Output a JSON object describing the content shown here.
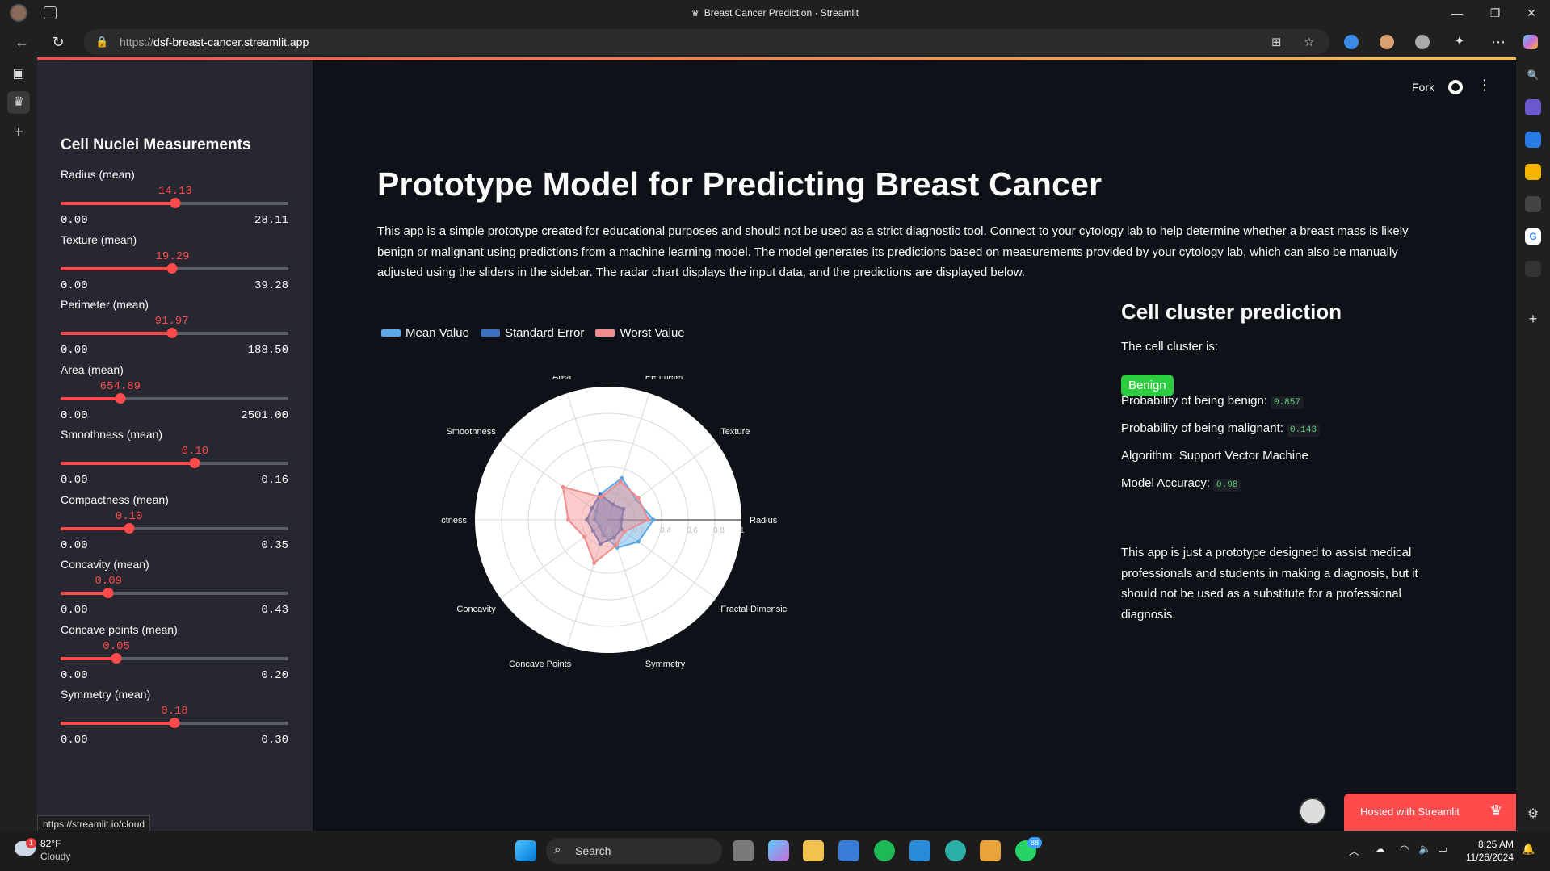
{
  "browser": {
    "window_title": "Breast Cancer Prediction · Streamlit",
    "url_prefix": "https://",
    "url_host": "dsf-breast-cancer.streamlit.app",
    "status_url": "https://streamlit.io/cloud"
  },
  "sidebar": {
    "title": "Cell Nuclei Measurements",
    "sliders": [
      {
        "label": "Radius (mean)",
        "value": "14.13",
        "min": "0.00",
        "max": "28.11",
        "fraction": 0.503
      },
      {
        "label": "Texture (mean)",
        "value": "19.29",
        "min": "0.00",
        "max": "39.28",
        "fraction": 0.491
      },
      {
        "label": "Perimeter (mean)",
        "value": "91.97",
        "min": "0.00",
        "max": "188.50",
        "fraction": 0.488
      },
      {
        "label": "Area (mean)",
        "value": "654.89",
        "min": "0.00",
        "max": "2501.00",
        "fraction": 0.262
      },
      {
        "label": "Smoothness (mean)",
        "value": "0.10",
        "min": "0.00",
        "max": "0.16",
        "fraction": 0.59
      },
      {
        "label": "Compactness (mean)",
        "value": "0.10",
        "min": "0.00",
        "max": "0.35",
        "fraction": 0.3
      },
      {
        "label": "Concavity (mean)",
        "value": "0.09",
        "min": "0.00",
        "max": "0.43",
        "fraction": 0.21
      },
      {
        "label": "Concave points (mean)",
        "value": "0.05",
        "min": "0.00",
        "max": "0.20",
        "fraction": 0.245
      },
      {
        "label": "Symmetry (mean)",
        "value": "0.18",
        "min": "0.00",
        "max": "0.30",
        "fraction": 0.5
      }
    ]
  },
  "header": {
    "fork_label": "Fork"
  },
  "main": {
    "title": "Prototype Model for Predicting Breast Cancer",
    "description": "This app is a simple prototype created for educational purposes and should not be used as a strict diagnostic tool. Connect to your cytology lab to help determine whether a breast mass is likely benign or malignant using predictions from a machine learning model. The model generates its predictions based on measurements provided by your cytology lab, which can also be manually adjusted using the sliders in the sidebar. The radar chart displays the input data, and the predictions are displayed below."
  },
  "chart_data": {
    "type": "radar",
    "categories": [
      "Radius",
      "Texture",
      "Perimeter",
      "Area",
      "Smoothness",
      "Compactness",
      "Concavity",
      "Concave Points",
      "Symmetry",
      "Fractal Dimension"
    ],
    "category_labels_shown": [
      "Radius",
      "Texture",
      "Perimeter",
      "Area",
      "Smoothness",
      "Compactness",
      "Concavity",
      "Concave Points",
      "Symmetry",
      "Fractal Dimensic"
    ],
    "radial_ticks": [
      "0",
      "0.2",
      "0.4",
      "0.6",
      "0.8",
      "1"
    ],
    "rlim": [
      0,
      1
    ],
    "legend": "top-left",
    "series": [
      {
        "name": "Mean Value",
        "color": "#5aa9e6",
        "values": [
          0.34,
          0.26,
          0.33,
          0.2,
          0.11,
          0.1,
          0.08,
          0.12,
          0.22,
          0.28
        ]
      },
      {
        "name": "Standard Error",
        "color": "#3d6fbf",
        "values": [
          0.1,
          0.14,
          0.12,
          0.2,
          0.15,
          0.16,
          0.14,
          0.19,
          0.14,
          0.12
        ]
      },
      {
        "name": "Worst Value",
        "color": "#f28b8b",
        "values": [
          0.3,
          0.28,
          0.3,
          0.18,
          0.42,
          0.3,
          0.22,
          0.34,
          0.2,
          0.15
        ]
      }
    ]
  },
  "prediction": {
    "title": "Cell cluster prediction",
    "cluster_label": "The cell cluster is:",
    "result": "Benign",
    "benign_label": "Probability of being benign:",
    "benign_value": "0.857",
    "malignant_label": "Probability of being malignant:",
    "malignant_value": "0.143",
    "algorithm": "Algorithm: Support Vector Machine",
    "accuracy_label": "Model Accuracy:",
    "accuracy_value": "0.98",
    "note": "This app is just a prototype designed to assist medical professionals and students in making a diagnosis, but it should not be used as a substitute for a professional diagnosis."
  },
  "hosted": "Hosted with Streamlit",
  "taskbar": {
    "temp": "82°F",
    "condition": "Cloudy",
    "weather_badge": "1",
    "search_label": "Search",
    "whatsapp_badge": "88",
    "time": "8:25 AM",
    "date": "11/26/2024"
  },
  "colors": {
    "accent": "#ff4b4b",
    "app_bg": "#0e1117",
    "sidebar_bg": "#262730",
    "benign_badge": "#2ecc40"
  }
}
